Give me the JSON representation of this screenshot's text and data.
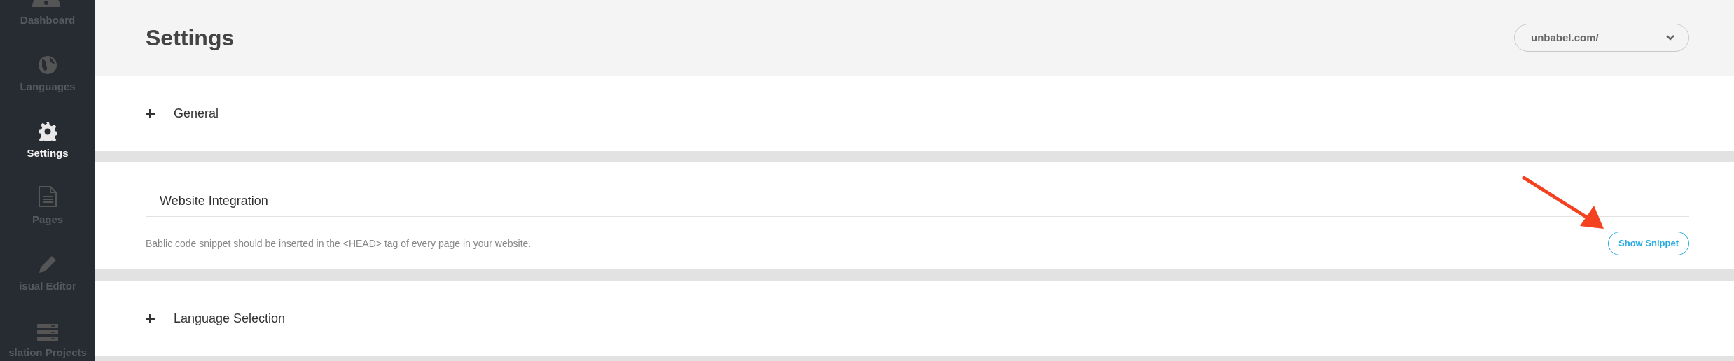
{
  "sidebar": {
    "items": [
      {
        "label": "Dashboard",
        "selected": false
      },
      {
        "label": "Languages",
        "selected": false
      },
      {
        "label": "Settings",
        "selected": true
      },
      {
        "label": "Pages",
        "selected": false
      },
      {
        "label": "isual Editor",
        "selected": false
      },
      {
        "label": "slation Projects",
        "selected": false
      }
    ]
  },
  "header": {
    "title": "Settings",
    "site_select": {
      "value": "unbabel.com/"
    }
  },
  "sections": [
    {
      "kind": "collapsible",
      "title": "General",
      "expanded": false
    },
    {
      "kind": "integration",
      "title": "Website Integration",
      "description": "Bablic code snippet should be inserted in the <HEAD> tag of every page in your website.",
      "button": "Show Snippet"
    },
    {
      "kind": "collapsible",
      "title": "Language Selection",
      "expanded": false
    }
  ]
}
